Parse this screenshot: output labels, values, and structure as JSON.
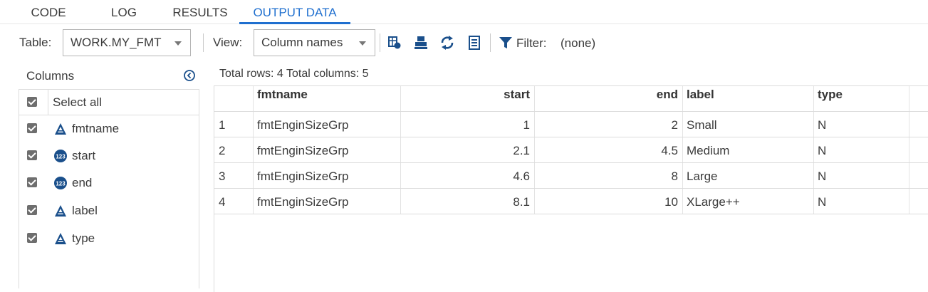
{
  "tabs": [
    {
      "label": "CODE",
      "active": false
    },
    {
      "label": "LOG",
      "active": false
    },
    {
      "label": "RESULTS",
      "active": false
    },
    {
      "label": "OUTPUT DATA",
      "active": true
    }
  ],
  "toolbar": {
    "table_label": "Table:",
    "table_value": "WORK.MY_FMT",
    "view_label": "View:",
    "view_value": "Column names",
    "filter_label": "Filter:",
    "filter_value": "(none)",
    "icons": [
      "table-properties-icon",
      "print-icon",
      "refresh-icon",
      "view-columns-icon",
      "filter-icon"
    ]
  },
  "columns_panel": {
    "header": "Columns",
    "select_all": "Select all",
    "items": [
      {
        "name": "fmtname",
        "type": "character",
        "checked": true
      },
      {
        "name": "start",
        "type": "numeric",
        "checked": true
      },
      {
        "name": "end",
        "type": "numeric",
        "checked": true
      },
      {
        "name": "label",
        "type": "character",
        "checked": true
      },
      {
        "name": "type",
        "type": "character",
        "checked": true
      }
    ]
  },
  "grid": {
    "summary": "Total rows: 4  Total columns: 5",
    "headers": [
      "fmtname",
      "start",
      "end",
      "label",
      "type"
    ],
    "rows": [
      {
        "num": "1",
        "fmtname": "fmtEnginSizeGrp",
        "start": "1",
        "end": "2",
        "label": "Small",
        "type": "N"
      },
      {
        "num": "2",
        "fmtname": "fmtEnginSizeGrp",
        "start": "2.1",
        "end": "4.5",
        "label": "Medium",
        "type": "N"
      },
      {
        "num": "3",
        "fmtname": "fmtEnginSizeGrp",
        "start": "4.6",
        "end": "8",
        "label": "Large",
        "type": "N"
      },
      {
        "num": "4",
        "fmtname": "fmtEnginSizeGrp",
        "start": "8.1",
        "end": "10",
        "label": "XLarge++",
        "type": "N"
      }
    ]
  },
  "colors": {
    "accent": "#1f6fcf",
    "icon_blue": "#1a4f8b"
  }
}
